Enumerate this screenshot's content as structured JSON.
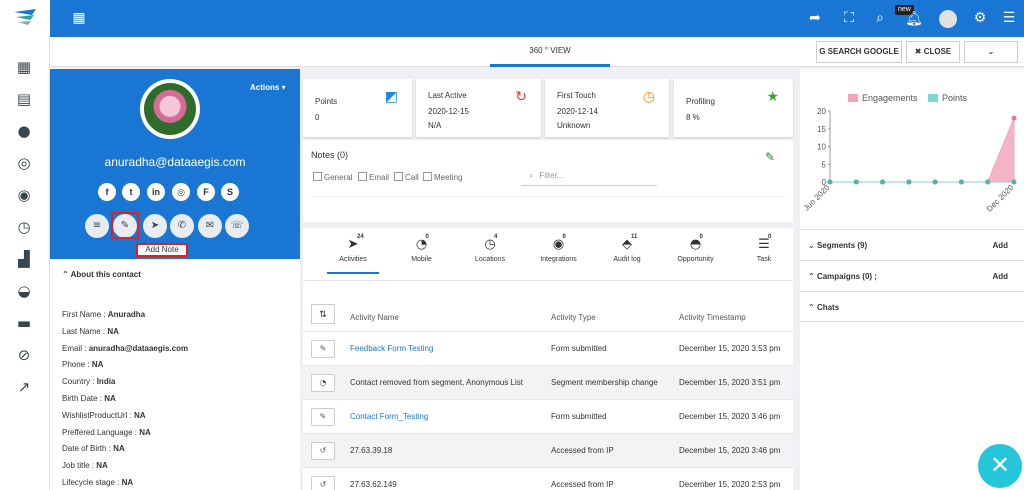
{
  "topbar": {
    "icons": [
      "grid-icon",
      "share-icon",
      "fullscreen-icon",
      "search-icon",
      "bell-icon",
      "avatar-icon",
      "gear-icon",
      "menu-icon"
    ],
    "new_badge": "new"
  },
  "subbar": {
    "view_tab": "360 ° VIEW",
    "search_google": "SEARCH GOOGLE",
    "close": "CLOSE"
  },
  "sidebar": {
    "icons": [
      "dashboard-icon",
      "calendar-icon",
      "user-icon",
      "lifebuoy-icon",
      "target-icon",
      "clock-icon",
      "puzzle-icon",
      "gauge-icon",
      "chat-icon",
      "block-icon",
      "chart-icon"
    ]
  },
  "profile": {
    "actions": "Actions",
    "email": "anuradha@dataaegis.com",
    "add_note": "Add Note"
  },
  "about": {
    "title": "About this contact",
    "fields": [
      {
        "label": "First Name :",
        "value": "Anuradha"
      },
      {
        "label": "Last Name :",
        "value": "NA"
      },
      {
        "label": "Email :",
        "value": "anuradha@dataaegis.com"
      },
      {
        "label": "Phone :",
        "value": "NA"
      },
      {
        "label": "Country :",
        "value": "India"
      },
      {
        "label": "Birth Date :",
        "value": "NA"
      },
      {
        "label": "WishlistProductUrl :",
        "value": "NA"
      },
      {
        "label": "Preffered Language :",
        "value": "NA"
      },
      {
        "label": "Date of Birth :",
        "value": "NA"
      },
      {
        "label": "Job title :",
        "value": "NA"
      },
      {
        "label": "Lifecycle stage :",
        "value": "NA"
      }
    ]
  },
  "cards": {
    "points": {
      "label": "Points",
      "value": "0"
    },
    "last_active": {
      "label": "Last Active",
      "date": "2020-12-15",
      "value": "N/A"
    },
    "first_touch": {
      "label": "First Touch",
      "date": "2020-12-14",
      "value": "Unknown"
    },
    "profiling": {
      "label": "Profiling",
      "value": "8 %"
    }
  },
  "notes": {
    "title": "Notes (0)",
    "filters": [
      "General",
      "Email",
      "Call",
      "Meeting"
    ],
    "filter_placeholder": "Filter..."
  },
  "activity": {
    "tabs": [
      {
        "label": "Activities",
        "count": "24"
      },
      {
        "label": "Mobile",
        "count": "0"
      },
      {
        "label": "Locations",
        "count": "4"
      },
      {
        "label": "Integrations",
        "count": "0"
      },
      {
        "label": "Audit log",
        "count": "11"
      },
      {
        "label": "Opportunity",
        "count": "0"
      },
      {
        "label": "Task",
        "count": "0"
      }
    ],
    "headers": [
      "Activity Name",
      "Activity Type",
      "Activity Timestamp"
    ],
    "rows": [
      {
        "name": "Feedback Form Testing",
        "type": "Form submitted",
        "time": "December 15, 2020 3:53 pm"
      },
      {
        "name": "Contact removed from segment, Anonymous List",
        "type": "Segment membership change",
        "time": "December 15, 2020 3:51 pm"
      },
      {
        "name": "Contact Form_Testing",
        "type": "Form submitted",
        "time": "December 15, 2020 3:46 pm"
      },
      {
        "name": "27.63.39.18",
        "type": "Accessed from IP",
        "time": "December 15, 2020 3:46 pm"
      },
      {
        "name": "27.63.62.149",
        "type": "Accessed from IP",
        "time": "December 15, 2020 2:53 pm"
      }
    ]
  },
  "right": {
    "segments": {
      "title": "Segments (9)",
      "action": "Add"
    },
    "campaigns": {
      "title": "Campaigns (0) ;",
      "action": "Add"
    },
    "chats": {
      "title": "Chats"
    }
  },
  "chart_data": {
    "type": "area",
    "series": [
      {
        "name": "Engagements",
        "values": [
          0,
          0,
          0,
          0,
          0,
          0,
          0,
          18
        ],
        "color": "#f4a3b8"
      },
      {
        "name": "Points",
        "values": [
          0,
          0,
          0,
          0,
          0,
          0,
          0,
          0
        ],
        "color": "#7fd6d0"
      }
    ],
    "x_tick_labels": [
      "Jun 2020",
      "Dec 2020"
    ],
    "y_ticks": [
      "0",
      "5",
      "10",
      "15",
      "20"
    ],
    "ylim": [
      0,
      20
    ],
    "legend": "top"
  },
  "colors": {
    "brand": "#1976d2",
    "fab": "#26c6da",
    "highlight": "#e02020"
  }
}
